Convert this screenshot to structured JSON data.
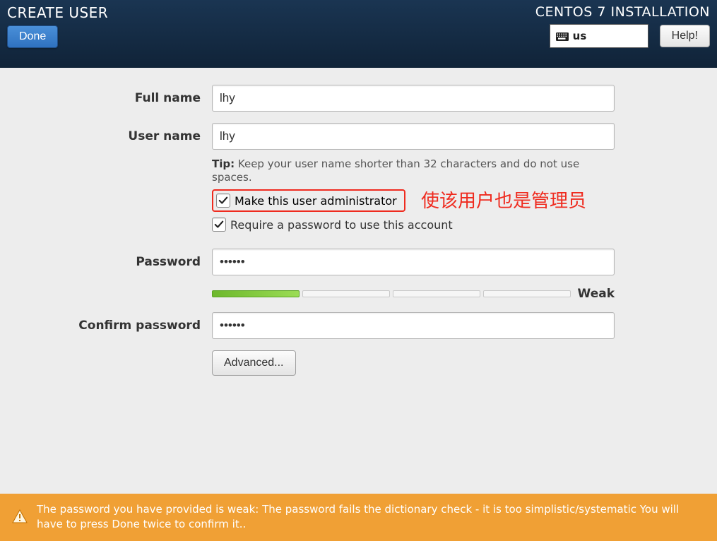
{
  "header": {
    "page_title": "CREATE USER",
    "done_label": "Done",
    "install_title": "CENTOS 7 INSTALLATION",
    "keyboard_layout": "us",
    "help_label": "Help!"
  },
  "form": {
    "full_name_label": "Full name",
    "full_name_value": "lhy",
    "user_name_label": "User name",
    "user_name_value": "lhy",
    "tip_lead": "Tip:",
    "tip_text": "Keep your user name shorter than 32 characters and do not use spaces.",
    "make_admin_label": "Make this user administrator",
    "make_admin_checked": true,
    "require_password_label": "Require a password to use this account",
    "require_password_checked": true,
    "password_label": "Password",
    "password_value": "••••••",
    "strength_label": "Weak",
    "confirm_password_label": "Confirm password",
    "confirm_password_value": "••••••",
    "advanced_label": "Advanced..."
  },
  "annotation": {
    "text": "使该用户也是管理员"
  },
  "warning": {
    "message": "The password you have provided is weak: The password fails the dictionary check - it is too simplistic/systematic You will have to press Done twice to confirm it.."
  }
}
